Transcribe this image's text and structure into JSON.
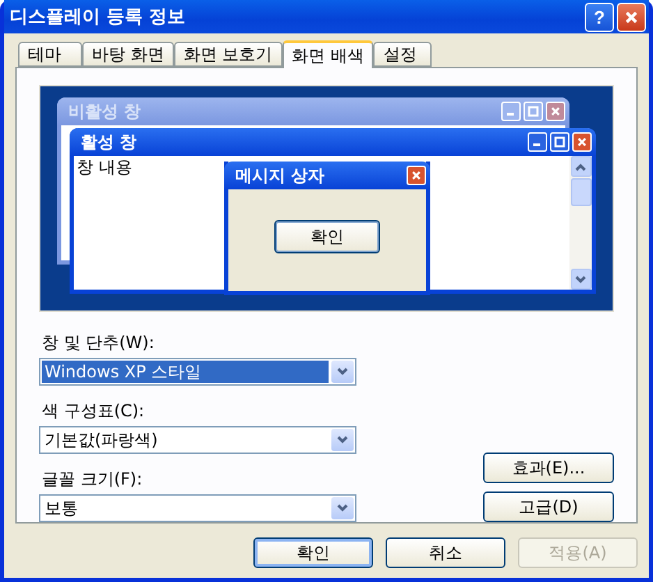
{
  "window": {
    "title": "디스플레이 등록 정보",
    "help": "?"
  },
  "tabs": [
    {
      "label": "테마",
      "selected": false
    },
    {
      "label": "바탕 화면",
      "selected": false
    },
    {
      "label": "화면 보호기",
      "selected": false
    },
    {
      "label": "화면 배색",
      "selected": true
    },
    {
      "label": "설정",
      "selected": false
    }
  ],
  "preview": {
    "windows": [
      {
        "title": "비활성 창",
        "active": false
      },
      {
        "title": "활성 창",
        "active": true,
        "content": "창 내용"
      }
    ],
    "message_box": {
      "title": "메시지 상자",
      "button": "확인"
    }
  },
  "fields": [
    {
      "label": "창 및 단추(W):",
      "value": "Windows XP 스타일",
      "focused": true
    },
    {
      "label": "색 구성표(C):",
      "value": "기본값(파랑색)",
      "focused": false
    },
    {
      "label": "글꼴 크기(F):",
      "value": "보통",
      "focused": false
    }
  ],
  "side_buttons": [
    "효과(E)...",
    "고급(D)"
  ],
  "dialog_buttons": [
    {
      "label": "확인",
      "default": true,
      "disabled": false
    },
    {
      "label": "취소",
      "default": false,
      "disabled": false
    },
    {
      "label": "적용(A)",
      "default": false,
      "disabled": true
    }
  ]
}
